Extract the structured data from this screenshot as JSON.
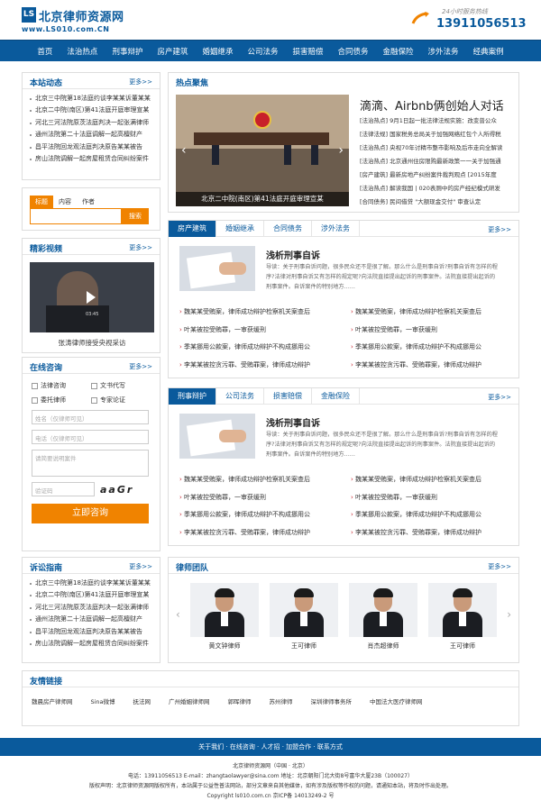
{
  "header": {
    "logo_mark": "LS",
    "logo_title": "北京律师资源网",
    "logo_url": "www.LS010.com.CN",
    "hotline_caption": "24小时服务热线",
    "hotline_number": "13911056513"
  },
  "nav": [
    "首页",
    "法治热点",
    "刑事辩护",
    "房产建筑",
    "婚姻继承",
    "公司法务",
    "损害赔偿",
    "合同债务",
    "金融保险",
    "涉外法务",
    "经典案例"
  ],
  "more_label": "更多>>",
  "news_box": {
    "title": "本站动态",
    "items": [
      "北京三中院第18法庭约谈李某某诉董某某",
      "北京二中院(南区)第41法庭开庭审理宣某",
      "河北三河法院原茨法庭判决一起张满律师",
      "通州法院第二十法庭调解一起高檀财产",
      "昌平法院回龙观法庭判决原告某某被告",
      "房山法院调解一起房屋租赁合同纠纷案件"
    ]
  },
  "search": {
    "tabs": [
      "标题",
      "内容",
      "作者"
    ],
    "button": "搜索"
  },
  "video_box": {
    "title": "精彩视频",
    "time": "03:45",
    "caption": "张涛律师接受央视采访"
  },
  "consult": {
    "title": "在线咨询",
    "options": [
      "法律咨询",
      "文书代写",
      "委托律师",
      "专家论证"
    ],
    "name_placeholder": "姓名（仅律师可见）",
    "phone_placeholder": "电话（仅律师可见）",
    "case_placeholder": "请简要说明案件",
    "captcha_placeholder": "验证码",
    "captcha_text": "aaGr",
    "submit": "立即咨询"
  },
  "guide_box": {
    "title": "诉讼指南",
    "items": [
      "北京三中院第18法庭约谈李某某诉董某某",
      "北京二中院(南区)第41法庭开庭审理宣某",
      "河北三河法院原茨法庭判决一起张满律师",
      "通州法院第二十法庭调解一起高檀财产",
      "昌平法院回龙观法庭判决原告某某被告",
      "房山法院调解一起房屋租赁合同纠纷案件"
    ]
  },
  "hot": {
    "title": "热点聚焦",
    "slide_caption": "北京二中院(南区)第41法庭开庭审理宣某",
    "headline": "滴滴、Airbnb俩创始人对话",
    "items": [
      "[法治热点] 9月1日起一批法律法规实施：改变普公众",
      "[法律法规] 国家税务总局关于加强网络红包个人所得税",
      "[法治热点] 央视70年讨精市整市影响及后市走向全解读",
      "[法治热点] 北京通州住房限购最新政策一一关于加强通",
      "[房产建筑] 最新房地产纠纷案件裁判观点 [2015年度",
      "[法治热点] 解读我国 | 020表厕中的房产经纪模式研发",
      "[合同债务] 民间借贷 \"大额现金交付\" 审查认定"
    ]
  },
  "panel1": {
    "tabs": [
      "房产建筑",
      "婚姻继承",
      "合同债务",
      "涉外法务"
    ],
    "feature_title": "浅析刑事自诉",
    "feature_desc": "导读：关于刑事自诉问题，很多民众还不是很了解。那么什么是刑事自诉?刑事自诉有怎样的程序?法律对刑事自诉又有怎样的规定呢?向法院直接提出起诉的刑事案件。法院直接提出起诉的刑事案件。自诉案件的特别地方……",
    "items": [
      "魏某某受贿案，律师成功辩护检察机关案查后",
      "魏某某受贿案，律师成功辩护检察机关案查后",
      "叶某被控受贿罪，一审获缓刑",
      "叶某被控受贿罪，一审获缓刑",
      "季某挪用公款案，律师成功辩护不构成挪用公",
      "季某挪用公款案，律师成功辩护不构成挪用公",
      "李某某被控贪污罪、受贿罪案，律师成功辩护",
      "李某某被控贪污罪、受贿罪案，律师成功辩护"
    ]
  },
  "panel2": {
    "tabs": [
      "刑事辩护",
      "公司法务",
      "损害赔偿",
      "金融保险"
    ],
    "feature_title": "浅析刑事自诉",
    "feature_desc": "导读：关于刑事自诉问题，很多民众还不是很了解。那么什么是刑事自诉?刑事自诉有怎样的程序?法律对刑事自诉又有怎样的规定呢?向法院直接提出起诉的刑事案件。法院直接提出起诉的刑事案件。自诉案件的特别地方……",
    "items": [
      "魏某某受贿案，律师成功辩护检察机关案查后",
      "魏某某受贿案，律师成功辩护检察机关案查后",
      "叶某被控受贿罪，一审获缓刑",
      "叶某被控受贿罪，一审获缓刑",
      "季某挪用公款案，律师成功辩护不构成挪用公",
      "季某挪用公款案，律师成功辩护不构成挪用公",
      "李某某被控贪污罪、受贿罪案，律师成功辩护",
      "李某某被控贪污罪、受贿罪案，律师成功辩护"
    ]
  },
  "team": {
    "title": "律师团队",
    "lawyers": [
      "黄文钟律师",
      "王可律师",
      "肖杰超律师",
      "王可律师"
    ]
  },
  "friend_links": {
    "title": "友情链接",
    "items": [
      "魏晨房产律师网",
      "Sina微博",
      "抚法网",
      "广州婚姻律师网",
      "郭晖律师",
      "苏州律师",
      "深圳律师事务所",
      "中国法大医疗律师网"
    ]
  },
  "footer": {
    "nav": "关于我们 · 在线咨询 · 人才招 · 加盟合作 · 联系方式",
    "line1": "北京律师资源网（中国 · 北京）",
    "line2": "电话：13911056513          E-mail：zhangtaolawyer@sina.com          地址：北京朝阳门北大街8号富华大厦23B（100027）",
    "line3": "版权声明：北京律师资源网版权所有，本站属于公益性普法网站，部分文章来自其他媒体，如有涉及版权等作权的问题，请通知本站，将及时作出处理。",
    "line4": "Copyright  ls010.com.cn 京ICP备 14013249-2 号"
  }
}
